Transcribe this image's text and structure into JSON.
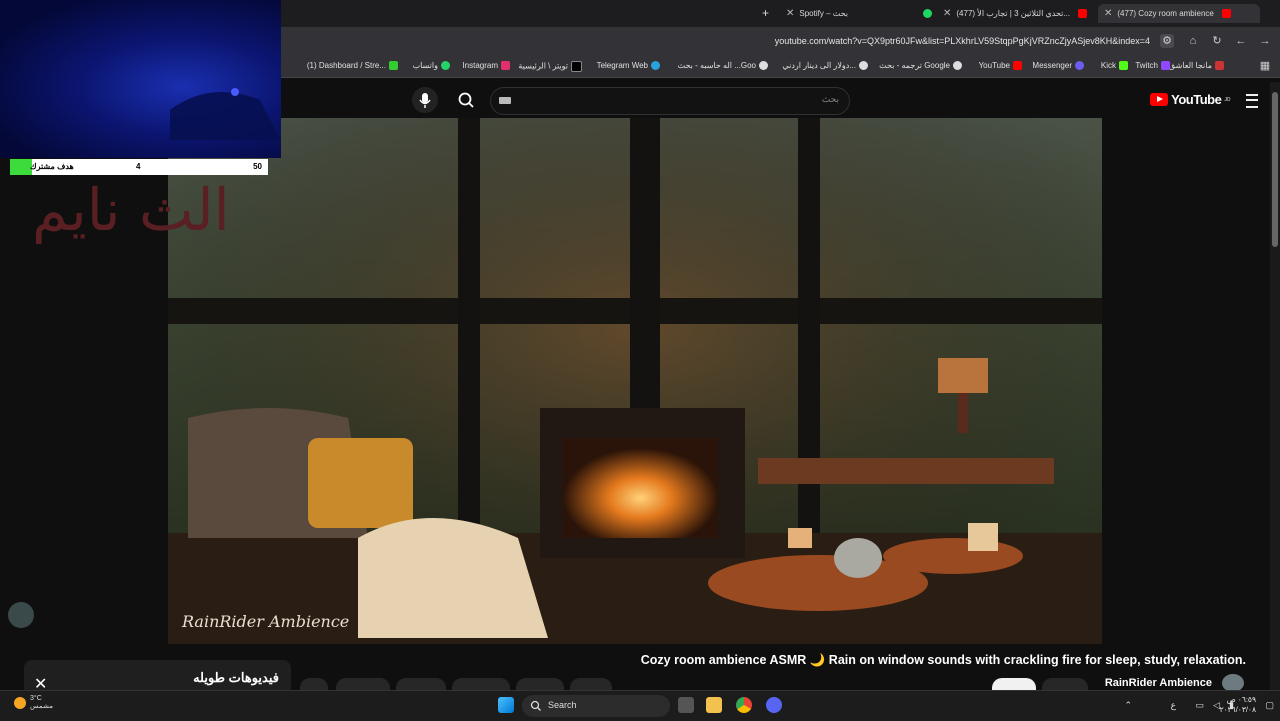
{
  "browser": {
    "tabs": [
      {
        "label": "(477) Cozy room ambience",
        "active": true
      },
      {
        "label": "(477) تحدي الثلاثين 3 | تجارب الأ..."
      },
      {
        "label": "Spotify – بحث"
      }
    ],
    "new_tab_label": "+",
    "url": "youtube.com/watch?v=QX9ptr60JFw&list=PLXkhrLV59StqpPgKjVRZncZjyASjev8KH&index=4",
    "bookmarks": [
      "مانجا العاشق",
      "Twitch",
      "Kick",
      "Messenger",
      "YouTube",
      "ترجمه - بحث Google",
      "دولار الى دينار اردني...",
      "اله حاسبه - بحث ...Goo",
      "Telegram Web",
      "تويتر \\ الرئيسية",
      "Instagram",
      "واتساب",
      "(1) Dashboard / Stre..."
    ]
  },
  "youtube": {
    "logo_text": "YouTube",
    "logo_sup": "JO",
    "search_placeholder": "بحث",
    "video_title": "Cozy room ambience ASMR 🌙 Rain on window sounds with crackling fire for sleep, study, relaxation.",
    "channel_name": "RainRider Ambience",
    "watermark": "RainRider Ambience",
    "panel_title": "فيديوهات طويله",
    "panel_close": "✕"
  },
  "overlay": {
    "goal_label": "هدف مشترك",
    "goal_current": "4",
    "goal_target": "50",
    "streamer_text": "الث نايم"
  },
  "taskbar": {
    "weather_temp": "3°C",
    "weather_desc": "مشمس",
    "search_label": "Search",
    "clock_time": "٠٦:٥٩ ص",
    "clock_date": "٢٠٢٦/٠٣/٠٨",
    "lang": "ع"
  },
  "colors": {
    "accent_red": "#ff0000",
    "goal_green": "#3ddc3d",
    "cam_blue": "#1a2fb0"
  }
}
